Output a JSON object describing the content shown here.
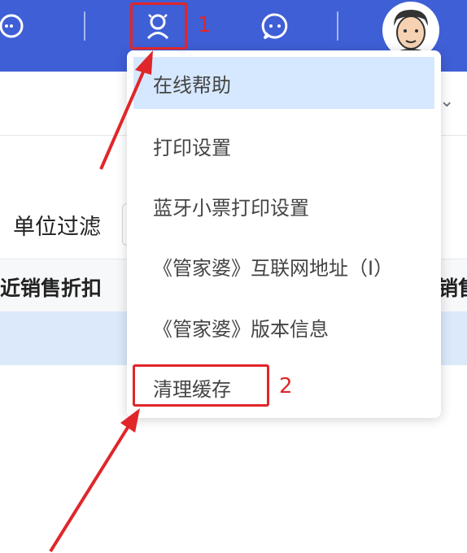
{
  "header": {
    "icons": [
      "headset-icon",
      "assistant-icon",
      "chat-bubble-icon",
      "user-avatar-icon"
    ]
  },
  "page": {
    "filter_label": "单位过滤",
    "table_header_left": "近销售折扣",
    "table_header_right": "销售"
  },
  "menu": {
    "items": [
      {
        "label": "在线帮助"
      },
      {
        "label": "打印设置"
      },
      {
        "label": "蓝牙小票打印设置"
      },
      {
        "label": "《管家婆》互联网地址（I）"
      },
      {
        "label": "《管家婆》版本信息"
      },
      {
        "label": "清理缓存"
      }
    ]
  },
  "annotations": {
    "label_1": "1",
    "label_2": "2",
    "color": "#e0262a"
  },
  "colors": {
    "header": "#3f5fd6",
    "menu_active": "#d6e8ff",
    "row_highlight": "#dbe9fb"
  }
}
